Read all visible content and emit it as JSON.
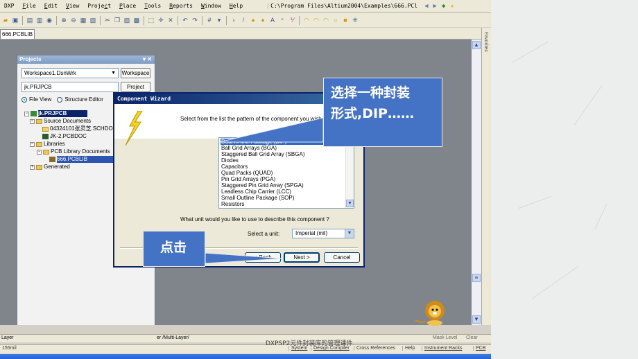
{
  "app": {
    "menu": [
      {
        "label": "DXP",
        "u": ""
      },
      {
        "label": "File",
        "u": "F"
      },
      {
        "label": "Edit",
        "u": "E"
      },
      {
        "label": "View",
        "u": "V"
      },
      {
        "label": "Project",
        "u": "c"
      },
      {
        "label": "Place",
        "u": "P"
      },
      {
        "label": "Tools",
        "u": "T"
      },
      {
        "label": "Reports",
        "u": "R"
      },
      {
        "label": "Window",
        "u": "W"
      },
      {
        "label": "Help",
        "u": "H"
      }
    ],
    "path": "C:\\Program Files\\Altium2004\\Examples\\666.PCl",
    "doc_tab": "666.PCBLIB",
    "favorites": "Favorites"
  },
  "projects_panel": {
    "title": "Projects",
    "workspace_combo": "Workspace1.DsnWrk",
    "workspace_button": "Workspace",
    "project_combo": "jk.PRJPCB",
    "project_button": "Project",
    "file_view": "File View",
    "structure_editor": "Structure Editor",
    "tree": {
      "project": "jk.PRJPCB",
      "source_documents": "Source Documents",
      "sch_doc": "04324101张灵芝.SCHDO",
      "pcb_doc": "JK-2.PCBDOC",
      "libraries": "Libraries",
      "pcb_lib_docs": "PCB Library Documents",
      "pcb_lib": "666.PCBLIB",
      "generated": "Generated"
    }
  },
  "wizard": {
    "title": "Component Wizard",
    "prompt": "Select from the list the pattern of the component you wish to c",
    "patterns": [
      "Dual in-line Package (DIP)",
      "Ball Grid Arrays (BGA)",
      "Staggered Ball Grid Array (SBGA)",
      "Diodes",
      "Capacitors",
      "Quad Packs (QUAD)",
      "Pin Grid Arrays (PGA)",
      "Staggered Pin Grid Array (SPGA)",
      "Leadless Chip Carrier (LCC)",
      "Small Outline Package (SOP)",
      "Resistors"
    ],
    "unit_question": "What unit would you like to use to describe this component ?",
    "unit_label": "Select a unit:",
    "unit_value": "Imperial (mil)",
    "back_button": "< Back",
    "next_button": "Next >",
    "cancel_button": "Cancel"
  },
  "callouts": {
    "top_line1": "选择一种封装",
    "top_line2": "形式,DIP……",
    "bottom": "点击"
  },
  "bottom": {
    "left_layer": "Layer",
    "layer_tab": "er /Multi-Layer/",
    "mask_level": "Mask Level",
    "clear": "Clear",
    "coord": "155mil",
    "status_items": [
      "System",
      "Design Compiler",
      "Cross References",
      "Help",
      "Instrument Racks",
      "PCB"
    ],
    "caption": "DXPSP2元件封装库的管理课件"
  },
  "colors": {
    "callout": "#4472c4",
    "selection": "#316ac5",
    "workspace": "#7f858a"
  }
}
